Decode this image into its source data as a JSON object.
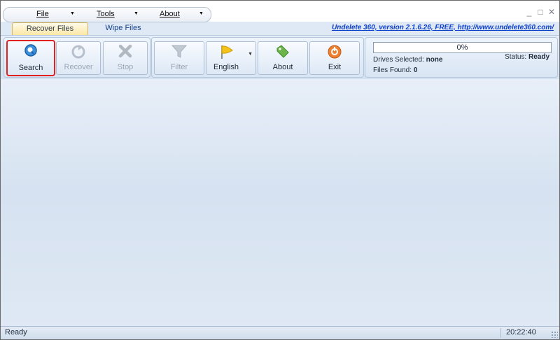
{
  "menu": {
    "items": [
      {
        "label": "File"
      },
      {
        "label": "Tools"
      },
      {
        "label": "About"
      }
    ]
  },
  "window_controls": {
    "minimize": "_",
    "maximize": "□",
    "close": "✕"
  },
  "tabs": [
    {
      "label": "Recover Files",
      "active": true
    },
    {
      "label": "Wipe Files",
      "active": false
    }
  ],
  "header_link": "Undelete 360, version 2.1.6.26, FREE, http://www.undelete360.com/",
  "ribbon": {
    "search": {
      "label": "Search",
      "icon": "magnifier-icon"
    },
    "recover": {
      "label": "Recover",
      "icon": "recover-icon"
    },
    "stop": {
      "label": "Stop",
      "icon": "stop-x-icon"
    },
    "filter": {
      "label": "Filter",
      "icon": "funnel-icon"
    },
    "language": {
      "label": "English",
      "icon": "flag-icon"
    },
    "about": {
      "label": "About",
      "icon": "tag-icon"
    },
    "exit": {
      "label": "Exit",
      "icon": "power-icon"
    }
  },
  "status_panel": {
    "progress_text": "0%",
    "progress_value": 0,
    "drives_label": "Drives Selected:",
    "drives_value": "none",
    "files_label": "Files Found:",
    "files_value": "0",
    "status_label": "Status:",
    "status_value": "Ready"
  },
  "statusbar": {
    "left": "Ready",
    "time": "20:22:40"
  },
  "colors": {
    "accent": "#15428b",
    "highlight_border": "#e12020",
    "link": "#0b3ec9"
  }
}
